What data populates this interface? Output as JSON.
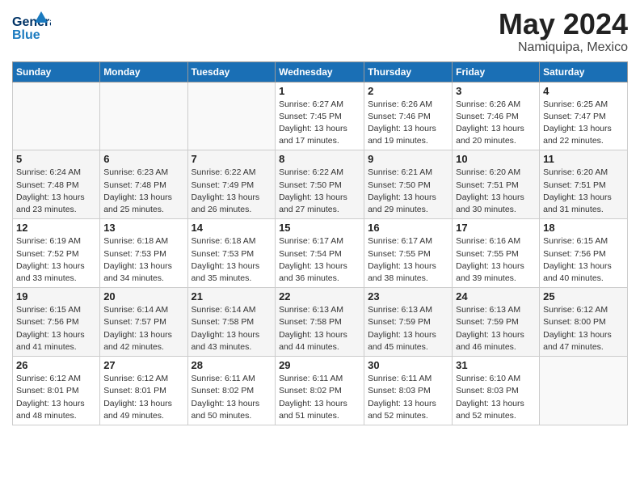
{
  "header": {
    "logo_line1": "General",
    "logo_line2": "Blue",
    "title": "May 2024",
    "subtitle": "Namiquipa, Mexico"
  },
  "calendar": {
    "weekdays": [
      "Sunday",
      "Monday",
      "Tuesday",
      "Wednesday",
      "Thursday",
      "Friday",
      "Saturday"
    ],
    "weeks": [
      [
        {
          "day": "",
          "info": ""
        },
        {
          "day": "",
          "info": ""
        },
        {
          "day": "",
          "info": ""
        },
        {
          "day": "1",
          "info": "Sunrise: 6:27 AM\nSunset: 7:45 PM\nDaylight: 13 hours\nand 17 minutes."
        },
        {
          "day": "2",
          "info": "Sunrise: 6:26 AM\nSunset: 7:46 PM\nDaylight: 13 hours\nand 19 minutes."
        },
        {
          "day": "3",
          "info": "Sunrise: 6:26 AM\nSunset: 7:46 PM\nDaylight: 13 hours\nand 20 minutes."
        },
        {
          "day": "4",
          "info": "Sunrise: 6:25 AM\nSunset: 7:47 PM\nDaylight: 13 hours\nand 22 minutes."
        }
      ],
      [
        {
          "day": "5",
          "info": "Sunrise: 6:24 AM\nSunset: 7:48 PM\nDaylight: 13 hours\nand 23 minutes."
        },
        {
          "day": "6",
          "info": "Sunrise: 6:23 AM\nSunset: 7:48 PM\nDaylight: 13 hours\nand 25 minutes."
        },
        {
          "day": "7",
          "info": "Sunrise: 6:22 AM\nSunset: 7:49 PM\nDaylight: 13 hours\nand 26 minutes."
        },
        {
          "day": "8",
          "info": "Sunrise: 6:22 AM\nSunset: 7:50 PM\nDaylight: 13 hours\nand 27 minutes."
        },
        {
          "day": "9",
          "info": "Sunrise: 6:21 AM\nSunset: 7:50 PM\nDaylight: 13 hours\nand 29 minutes."
        },
        {
          "day": "10",
          "info": "Sunrise: 6:20 AM\nSunset: 7:51 PM\nDaylight: 13 hours\nand 30 minutes."
        },
        {
          "day": "11",
          "info": "Sunrise: 6:20 AM\nSunset: 7:51 PM\nDaylight: 13 hours\nand 31 minutes."
        }
      ],
      [
        {
          "day": "12",
          "info": "Sunrise: 6:19 AM\nSunset: 7:52 PM\nDaylight: 13 hours\nand 33 minutes."
        },
        {
          "day": "13",
          "info": "Sunrise: 6:18 AM\nSunset: 7:53 PM\nDaylight: 13 hours\nand 34 minutes."
        },
        {
          "day": "14",
          "info": "Sunrise: 6:18 AM\nSunset: 7:53 PM\nDaylight: 13 hours\nand 35 minutes."
        },
        {
          "day": "15",
          "info": "Sunrise: 6:17 AM\nSunset: 7:54 PM\nDaylight: 13 hours\nand 36 minutes."
        },
        {
          "day": "16",
          "info": "Sunrise: 6:17 AM\nSunset: 7:55 PM\nDaylight: 13 hours\nand 38 minutes."
        },
        {
          "day": "17",
          "info": "Sunrise: 6:16 AM\nSunset: 7:55 PM\nDaylight: 13 hours\nand 39 minutes."
        },
        {
          "day": "18",
          "info": "Sunrise: 6:15 AM\nSunset: 7:56 PM\nDaylight: 13 hours\nand 40 minutes."
        }
      ],
      [
        {
          "day": "19",
          "info": "Sunrise: 6:15 AM\nSunset: 7:56 PM\nDaylight: 13 hours\nand 41 minutes."
        },
        {
          "day": "20",
          "info": "Sunrise: 6:14 AM\nSunset: 7:57 PM\nDaylight: 13 hours\nand 42 minutes."
        },
        {
          "day": "21",
          "info": "Sunrise: 6:14 AM\nSunset: 7:58 PM\nDaylight: 13 hours\nand 43 minutes."
        },
        {
          "day": "22",
          "info": "Sunrise: 6:13 AM\nSunset: 7:58 PM\nDaylight: 13 hours\nand 44 minutes."
        },
        {
          "day": "23",
          "info": "Sunrise: 6:13 AM\nSunset: 7:59 PM\nDaylight: 13 hours\nand 45 minutes."
        },
        {
          "day": "24",
          "info": "Sunrise: 6:13 AM\nSunset: 7:59 PM\nDaylight: 13 hours\nand 46 minutes."
        },
        {
          "day": "25",
          "info": "Sunrise: 6:12 AM\nSunset: 8:00 PM\nDaylight: 13 hours\nand 47 minutes."
        }
      ],
      [
        {
          "day": "26",
          "info": "Sunrise: 6:12 AM\nSunset: 8:01 PM\nDaylight: 13 hours\nand 48 minutes."
        },
        {
          "day": "27",
          "info": "Sunrise: 6:12 AM\nSunset: 8:01 PM\nDaylight: 13 hours\nand 49 minutes."
        },
        {
          "day": "28",
          "info": "Sunrise: 6:11 AM\nSunset: 8:02 PM\nDaylight: 13 hours\nand 50 minutes."
        },
        {
          "day": "29",
          "info": "Sunrise: 6:11 AM\nSunset: 8:02 PM\nDaylight: 13 hours\nand 51 minutes."
        },
        {
          "day": "30",
          "info": "Sunrise: 6:11 AM\nSunset: 8:03 PM\nDaylight: 13 hours\nand 52 minutes."
        },
        {
          "day": "31",
          "info": "Sunrise: 6:10 AM\nSunset: 8:03 PM\nDaylight: 13 hours\nand 52 minutes."
        },
        {
          "day": "",
          "info": ""
        }
      ]
    ]
  }
}
